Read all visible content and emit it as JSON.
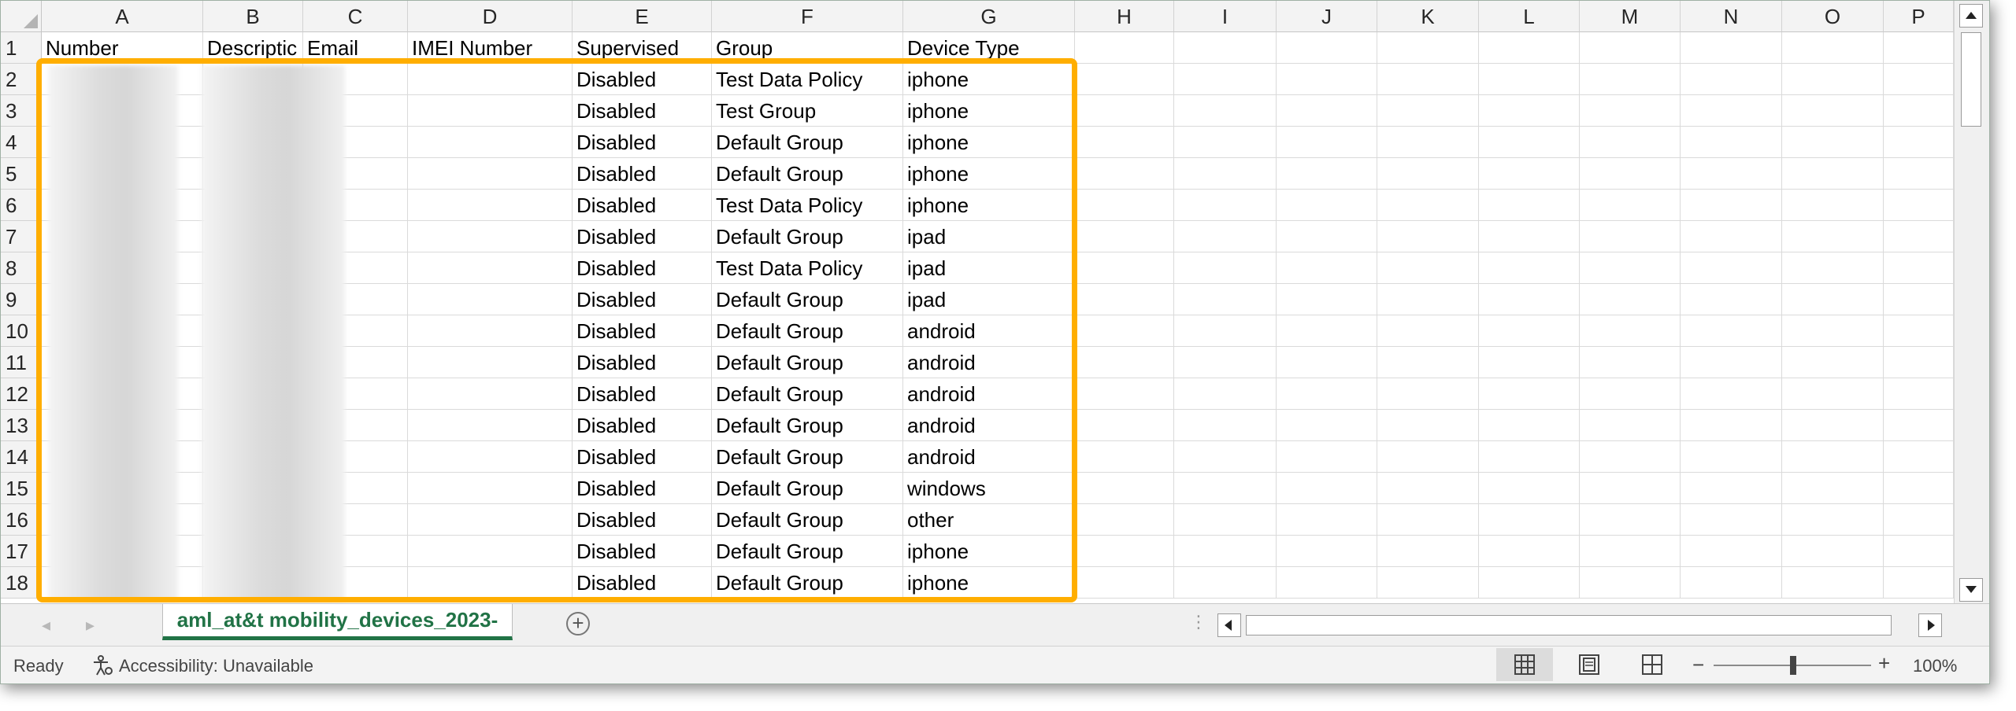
{
  "columns": [
    "A",
    "B",
    "C",
    "D",
    "E",
    "F",
    "G",
    "H",
    "I",
    "J",
    "K",
    "L",
    "M",
    "N",
    "O",
    "P"
  ],
  "headers": [
    "Number",
    "Descriptic",
    "Email",
    "IMEI Number",
    "Supervised",
    "Group",
    "Device Type"
  ],
  "rows": [
    {
      "num": "2",
      "supervised": "Disabled",
      "group": "Test Data Policy",
      "device": "iphone"
    },
    {
      "num": "3",
      "supervised": "Disabled",
      "group": "Test Group",
      "device": "iphone"
    },
    {
      "num": "4",
      "supervised": "Disabled",
      "group": "Default Group",
      "device": "iphone"
    },
    {
      "num": "5",
      "supervised": "Disabled",
      "group": "Default Group",
      "device": "iphone"
    },
    {
      "num": "6",
      "supervised": "Disabled",
      "group": "Test Data Policy",
      "device": "iphone"
    },
    {
      "num": "7",
      "supervised": "Disabled",
      "group": "Default Group",
      "device": "ipad"
    },
    {
      "num": "8",
      "supervised": "Disabled",
      "group": "Test Data Policy",
      "device": "ipad"
    },
    {
      "num": "9",
      "supervised": "Disabled",
      "group": "Default Group",
      "device": "ipad"
    },
    {
      "num": "10",
      "supervised": "Disabled",
      "group": "Default Group",
      "device": "android"
    },
    {
      "num": "11",
      "supervised": "Disabled",
      "group": "Default Group",
      "device": "android"
    },
    {
      "num": "12",
      "supervised": "Disabled",
      "group": "Default Group",
      "device": "android"
    },
    {
      "num": "13",
      "supervised": "Disabled",
      "group": "Default Group",
      "device": "android"
    },
    {
      "num": "14",
      "supervised": "Disabled",
      "group": "Default Group",
      "device": "android"
    },
    {
      "num": "15",
      "supervised": "Disabled",
      "group": "Default Group",
      "device": "windows"
    },
    {
      "num": "16",
      "supervised": "Disabled",
      "group": "Default Group",
      "device": "other"
    },
    {
      "num": "17",
      "supervised": "Disabled",
      "group": "Default Group",
      "device": "iphone"
    },
    {
      "num": "18",
      "supervised": "Disabled",
      "group": "Default Group",
      "device": "iphone"
    }
  ],
  "header_row_num": "1",
  "sheet_tab": "aml_at&t mobility_devices_2023-",
  "add_sheet": "+",
  "status": {
    "ready": "Ready",
    "accessibility": "Accessibility: Unavailable",
    "zoom_minus": "−",
    "zoom_plus": "+",
    "zoom": "100%",
    "zoom_level_percent": 100
  },
  "icons": {
    "accessibility": "accessibility-icon",
    "normal_view": "grid-view-icon",
    "page_layout": "page-layout-icon",
    "page_break": "page-break-icon"
  },
  "colors": {
    "highlight": "#ffae00",
    "excel_green": "#217346"
  }
}
